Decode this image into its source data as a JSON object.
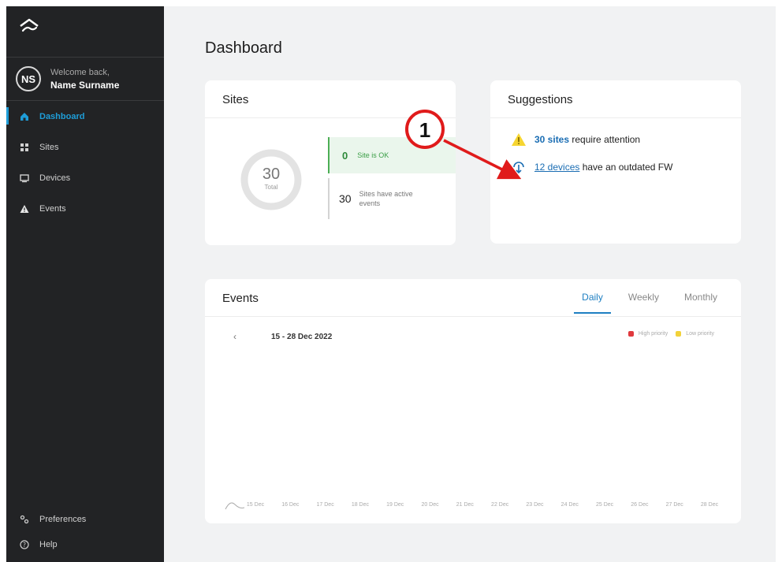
{
  "sidebar": {
    "user": {
      "initials": "NS",
      "welcome": "Welcome back,",
      "name": "Name Surname"
    },
    "nav": [
      {
        "label": "Dashboard",
        "icon": "home-icon",
        "active": true
      },
      {
        "label": "Sites",
        "icon": "sites-icon",
        "active": false
      },
      {
        "label": "Devices",
        "icon": "devices-icon",
        "active": false
      },
      {
        "label": "Events",
        "icon": "warning-icon",
        "active": false
      }
    ],
    "bottom": [
      {
        "label": "Preferences",
        "icon": "preferences-icon"
      },
      {
        "label": "Help",
        "icon": "help-icon"
      }
    ]
  },
  "page": {
    "title": "Dashboard"
  },
  "sites": {
    "title": "Sites",
    "total": "30",
    "total_label": "Total",
    "ok_count": "0",
    "ok_label": "Site is OK",
    "events_count": "30",
    "events_label": "Sites have active events"
  },
  "suggestions": {
    "title": "Suggestions",
    "items": [
      {
        "link": "30 sites",
        "text": " require attention",
        "icon": "warning-icon"
      },
      {
        "link": "12 devices",
        "text": " have an outdated FW",
        "icon": "firmware-update-icon"
      }
    ],
    "callout_number": "1"
  },
  "events": {
    "title": "Events",
    "tabs": [
      "Daily",
      "Weekly",
      "Monthly"
    ],
    "active_tab": "Daily",
    "prev_label": "‹",
    "range": "15 - 28 Dec 2022",
    "legend": [
      {
        "name": "High priority",
        "color": "#e0393e"
      },
      {
        "name": "Low priority",
        "color": "#f2d23a"
      }
    ]
  },
  "chart_data": {
    "type": "line",
    "title": "",
    "categories": [
      "15 Dec",
      "16 Dec",
      "17 Dec",
      "18 Dec",
      "19 Dec",
      "20 Dec",
      "21 Dec",
      "22 Dec",
      "23 Dec",
      "24 Dec",
      "25 Dec",
      "26 Dec",
      "27 Dec",
      "28 Dec"
    ],
    "series": [
      {
        "name": "High priority",
        "color": "#e0393e",
        "values": []
      },
      {
        "name": "Low priority",
        "color": "#f2d23a",
        "values": []
      }
    ],
    "grid": false,
    "legend": "top-right"
  }
}
